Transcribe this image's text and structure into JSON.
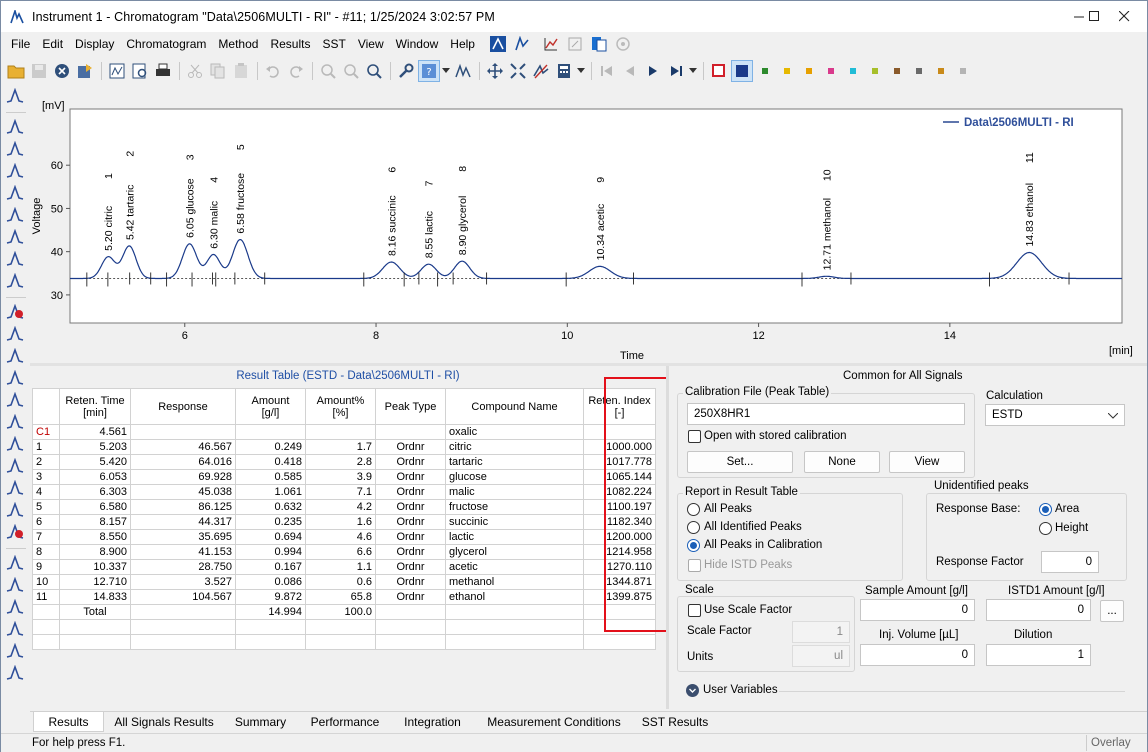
{
  "window": {
    "title": "Instrument 1 - Chromatogram \"Data\\2506MULTI - RI\" - #11;   1/25/2024   3:02:57 PM"
  },
  "menu": [
    "File",
    "Edit",
    "Display",
    "Chromatogram",
    "Method",
    "Results",
    "SST",
    "View",
    "Window",
    "Help"
  ],
  "color_swatches": [
    "#2d8a2d",
    "#e6b800",
    "#e6a000",
    "#d93a8c",
    "#21bcd6",
    "#a7bf2a",
    "#8a5a2b",
    "#6a6a6a",
    "#c98a1a",
    "#b4b4b4"
  ],
  "chart_data": {
    "type": "line",
    "yunit": "[mV]",
    "ylabel": "Voltage",
    "xlabel": "Time",
    "xunit": "[min]",
    "xlim": [
      4.8,
      15.8
    ],
    "ylim": [
      23.5,
      73
    ],
    "xticks": [
      6,
      8,
      10,
      12,
      14
    ],
    "yticks": [
      30,
      40,
      50,
      60
    ],
    "baseline": 33.8,
    "legend": "Data\\2506MULTI - RI",
    "legend_position": "top-right",
    "peaks": [
      {
        "rt": 5.2,
        "height": 5.0,
        "width": 0.07,
        "label": "5.20 citric",
        "num": "1"
      },
      {
        "rt": 5.42,
        "height": 7.5,
        "width": 0.07,
        "label": "5.42 tartaric",
        "num": "2"
      },
      {
        "rt": 6.05,
        "height": 8.0,
        "width": 0.075,
        "label": "6.05 glucose",
        "num": "3"
      },
      {
        "rt": 6.3,
        "height": 5.5,
        "width": 0.07,
        "label": "6.30 malic",
        "num": "4"
      },
      {
        "rt": 6.58,
        "height": 9.0,
        "width": 0.08,
        "label": "6.58 fructose",
        "num": "5"
      },
      {
        "rt": 8.16,
        "height": 3.8,
        "width": 0.09,
        "label": "8.16 succinic",
        "num": "6"
      },
      {
        "rt": 8.55,
        "height": 3.3,
        "width": 0.08,
        "label": "8.55 lactic",
        "num": "7"
      },
      {
        "rt": 8.9,
        "height": 4.0,
        "width": 0.08,
        "label": "8.90 glycerol",
        "num": "8"
      },
      {
        "rt": 10.34,
        "height": 2.8,
        "width": 0.11,
        "label": "10.34 acetic",
        "num": "9"
      },
      {
        "rt": 12.71,
        "height": 0.5,
        "width": 0.08,
        "label": "12.71 methanol",
        "num": "10"
      },
      {
        "rt": 14.83,
        "height": 6.0,
        "width": 0.13,
        "label": "14.83 ethanol",
        "num": "11"
      }
    ]
  },
  "result": {
    "title": "Result Table (ESTD - Data\\2506MULTI - RI)",
    "headers": [
      "",
      "Reten. Time\n[min]",
      "Response",
      "Amount\n[g/l]",
      "Amount%\n[%]",
      "Peak Type",
      "Compound Name",
      "Reten. Index\n[-]"
    ],
    "rows": [
      [
        "C1",
        "4.561",
        "",
        "",
        "",
        "",
        "oxalic",
        ""
      ],
      [
        "1",
        "5.203",
        "46.567",
        "0.249",
        "1.7",
        "Ordnr",
        "citric",
        "1000.000"
      ],
      [
        "2",
        "5.420",
        "64.016",
        "0.418",
        "2.8",
        "Ordnr",
        "tartaric",
        "1017.778"
      ],
      [
        "3",
        "6.053",
        "69.928",
        "0.585",
        "3.9",
        "Ordnr",
        "glucose",
        "1065.144"
      ],
      [
        "4",
        "6.303",
        "45.038",
        "1.061",
        "7.1",
        "Ordnr",
        "malic",
        "1082.224"
      ],
      [
        "5",
        "6.580",
        "86.125",
        "0.632",
        "4.2",
        "Ordnr",
        "fructose",
        "1100.197"
      ],
      [
        "6",
        "8.157",
        "44.317",
        "0.235",
        "1.6",
        "Ordnr",
        "succinic",
        "1182.340"
      ],
      [
        "7",
        "8.550",
        "35.695",
        "0.694",
        "4.6",
        "Ordnr",
        "lactic",
        "1200.000"
      ],
      [
        "8",
        "8.900",
        "41.153",
        "0.994",
        "6.6",
        "Ordnr",
        "glycerol",
        "1214.958"
      ],
      [
        "9",
        "10.337",
        "28.750",
        "0.167",
        "1.1",
        "Ordnr",
        "acetic",
        "1270.110"
      ],
      [
        "10",
        "12.710",
        "3.527",
        "0.086",
        "0.6",
        "Ordnr",
        "methanol",
        "1344.871"
      ],
      [
        "11",
        "14.833",
        "104.567",
        "9.872",
        "65.8",
        "Ordnr",
        "ethanol",
        "1399.875"
      ]
    ],
    "total": [
      "",
      "Total",
      "",
      "14.994",
      "100.0",
      "",
      "",
      ""
    ]
  },
  "common": {
    "title": "Common for All Signals",
    "calib_group": "Calibration File (Peak Table)",
    "calib_file": "250X8HR1",
    "open_stored": "Open with stored calibration",
    "set_btn": "Set...",
    "none_btn": "None",
    "view_btn": "View",
    "calc_label": "Calculation",
    "calc_value": "ESTD",
    "report_group": "Report in Result Table",
    "report_opts": [
      "All Peaks",
      "All Identified Peaks",
      "All Peaks in Calibration"
    ],
    "hide_istd": "Hide ISTD Peaks",
    "unident_group": "Unidentified peaks",
    "resp_base": "Response Base:",
    "area": "Area",
    "height": "Height",
    "resp_factor_label": "Response Factor",
    "resp_factor": "0",
    "scale_group": "Scale",
    "use_scale": "Use Scale Factor",
    "scale_factor_label": "Scale Factor",
    "scale_factor": "1",
    "units_label": "Units",
    "units": "ul",
    "sample_amount_label": "Sample Amount [g/l]",
    "sample_amount": "0",
    "istd_label": "ISTD1 Amount [g/l]",
    "istd_amount": "0",
    "dots_btn": "...",
    "inj_label": "Inj. Volume [µL]",
    "inj_volume": "0",
    "dilution_label": "Dilution",
    "dilution": "1",
    "user_vars": "User Variables"
  },
  "tabs": [
    "Results",
    "All Signals Results",
    "Summary",
    "Performance",
    "Integration",
    "Measurement Conditions",
    "SST Results"
  ],
  "status": {
    "help": "For help press F1.",
    "mode": "Overlay"
  }
}
